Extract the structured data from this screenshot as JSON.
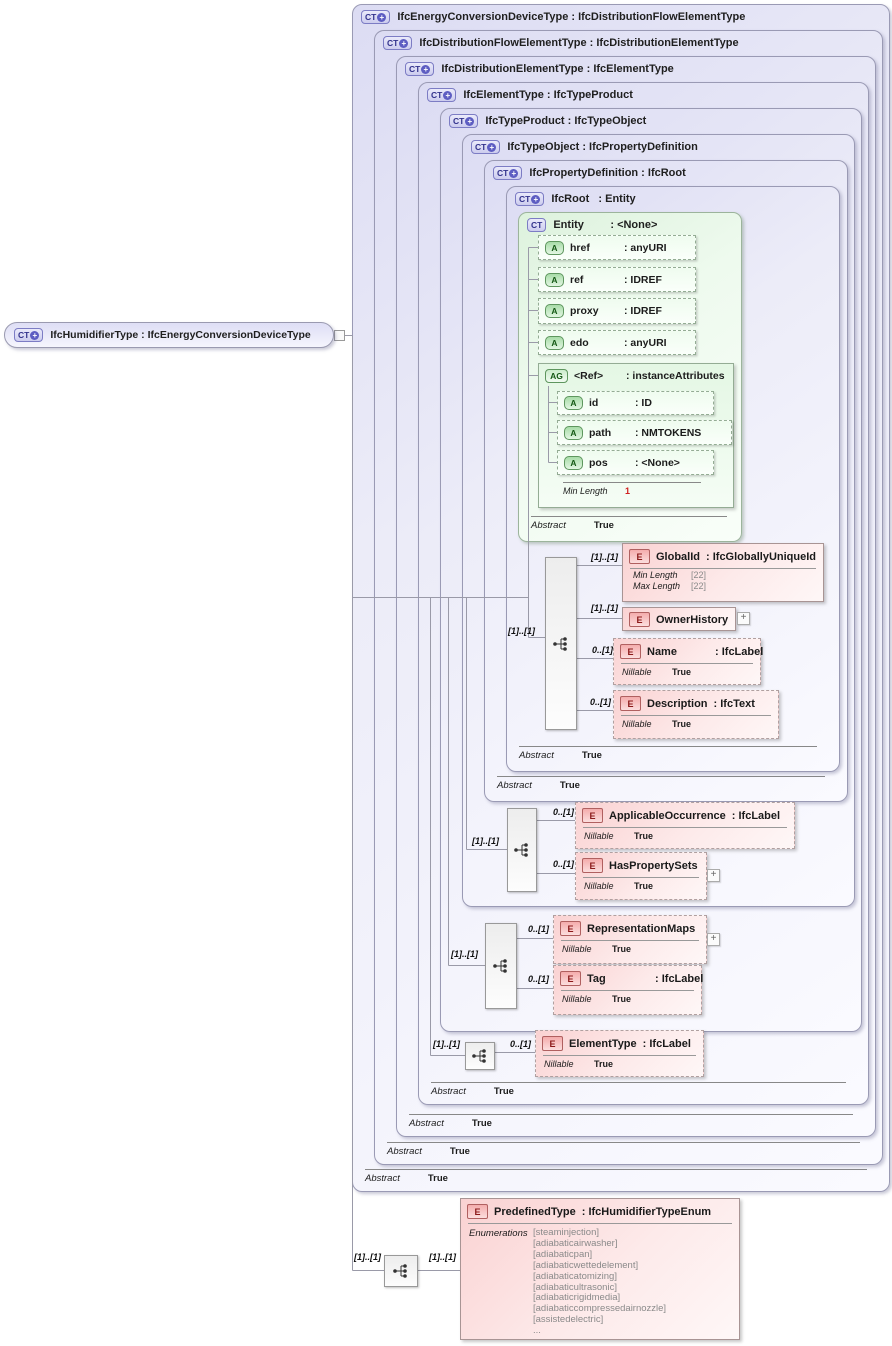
{
  "icons": {
    "ct": "CT",
    "plus": "+",
    "a": "A",
    "ag": "AG",
    "e": "E"
  },
  "labels": {
    "abstract": "Abstract",
    "nillable": "Nillable",
    "min_length": "Min Length",
    "max_length": "Max Length",
    "enumerations": "Enumerations"
  },
  "root": {
    "title": "IfcHumidifierType : IfcEnergyConversionDeviceType"
  },
  "hierarchy": [
    {
      "title": "IfcEnergyConversionDeviceType : IfcDistributionFlowElementType",
      "abstract": "True"
    },
    {
      "title": "IfcDistributionFlowElementType : IfcDistributionElementType",
      "abstract": "True"
    },
    {
      "title": "IfcDistributionElementType : IfcElementType",
      "abstract": "True"
    },
    {
      "title": "IfcElementType : IfcTypeProduct",
      "abstract": "True"
    },
    {
      "title": "IfcTypeProduct : IfcTypeObject"
    },
    {
      "title": "IfcTypeObject : IfcPropertyDefinition"
    },
    {
      "title": "IfcPropertyDefinition : IfcRoot",
      "abstract": "True"
    },
    {
      "title": "IfcRoot   : Entity",
      "abstract": "True"
    }
  ],
  "entity": {
    "name": "Entity",
    "type": ": <None>",
    "abstract": "True",
    "attributes": [
      {
        "name": "href",
        "type": ": anyURI"
      },
      {
        "name": "ref",
        "type": ": IDREF"
      },
      {
        "name": "proxy",
        "type": ": IDREF"
      },
      {
        "name": "edo",
        "type": ": anyURI"
      }
    ],
    "attribute_group": {
      "name": "<Ref>",
      "type": ": instanceAttributes",
      "attributes": [
        {
          "name": "id",
          "type": ": ID"
        },
        {
          "name": "path",
          "type": ": NMTOKENS"
        },
        {
          "name": "pos",
          "type": ": <None>"
        }
      ],
      "min_length": "1"
    }
  },
  "elements": {
    "global_id": {
      "name": "GlobalId",
      "type": ": IfcGloballyUniqueId",
      "cardinality": "[1]..[1]",
      "min_length": "[22]",
      "max_length": "[22]"
    },
    "owner_history": {
      "name": "OwnerHistory",
      "cardinality": "[1]..[1]"
    },
    "name": {
      "name": "Name",
      "type": ": IfcLabel",
      "cardinality": "0..[1]",
      "nillable": "True"
    },
    "description": {
      "name": "Description",
      "type": ": IfcText",
      "cardinality": "0..[1]",
      "nillable": "True"
    },
    "applicable_occurrence": {
      "name": "ApplicableOccurrence",
      "type": ": IfcLabel",
      "cardinality": "0..[1]",
      "nillable": "True"
    },
    "has_property_sets": {
      "name": "HasPropertySets",
      "cardinality": "0..[1]",
      "nillable": "True"
    },
    "representation_maps": {
      "name": "RepresentationMaps",
      "cardinality": "0..[1]",
      "nillable": "True"
    },
    "tag": {
      "name": "Tag",
      "type": ": IfcLabel",
      "cardinality": "0..[1]",
      "nillable": "True"
    },
    "element_type": {
      "name": "ElementType",
      "type": ": IfcLabel",
      "cardinality": "0..[1]",
      "nillable": "True"
    },
    "predefined_type": {
      "name": "PredefinedType",
      "type": ": IfcHumidifierTypeEnum",
      "cardinality": "[1]..[1]",
      "enumerations": [
        "[steaminjection]",
        "[adiabaticairwasher]",
        "[adiabaticpan]",
        "[adiabaticwettedelement]",
        "[adiabaticatomizing]",
        "[adiabaticultrasonic]",
        "[adiabaticrigidmedia]",
        "[adiabaticcompressedairnozzle]",
        "[assistedelectric]",
        "..."
      ]
    }
  },
  "sequences": {
    "ifcroot": "[1]..[1]",
    "ifctypeobject": "[1]..[1]",
    "ifctypeproduct": "[1]..[1]",
    "ifcelementtype": "[1]..[1]",
    "predefined_left": "[1]..[1]"
  },
  "colors": {
    "container_fill": "#dcdcf3",
    "entity_fill": "#ddf2dd",
    "element_fill": "#fad2d2",
    "line": "#9a9aa8",
    "red_value": "#d02020"
  }
}
